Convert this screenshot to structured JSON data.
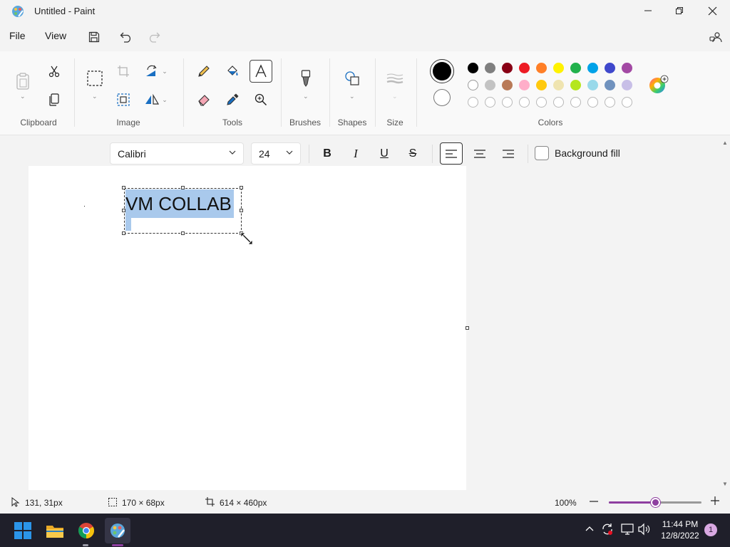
{
  "window": {
    "title": "Untitled - Paint"
  },
  "menu": {
    "file": "File",
    "view": "View"
  },
  "ribbon": {
    "groups": {
      "clipboard": "Clipboard",
      "image": "Image",
      "tools": "Tools",
      "brushes": "Brushes",
      "shapes": "Shapes",
      "size": "Size",
      "colors": "Colors"
    },
    "colors": {
      "primary": "#000000",
      "secondary": "#ffffff",
      "palette_row1": [
        "#000000",
        "#7f7f7f",
        "#880015",
        "#ed1c24",
        "#ff7f27",
        "#fff200",
        "#22b14c",
        "#00a2e8",
        "#3f48cc",
        "#a349a4"
      ],
      "palette_row2": [
        "#ffffff",
        "#c3c3c3",
        "#b97a57",
        "#ffaec9",
        "#ffc90e",
        "#efe4b0",
        "#b5e61d",
        "#99d9ea",
        "#7092be",
        "#c8bfe7"
      ]
    }
  },
  "textbar": {
    "font": "Calibri",
    "size": "24",
    "background_fill": "Background fill",
    "bold": "B",
    "italic": "I",
    "underline": "U",
    "strike": "S"
  },
  "canvas": {
    "text": "VM COLLAB"
  },
  "status": {
    "cursor": "131, 31px",
    "selection": "170 × 68px",
    "canvas_size": "614 × 460px",
    "zoom": "100%",
    "zoom_level": 0.5
  },
  "taskbar": {
    "time": "11:44 PM",
    "date": "12/8/2022",
    "notification_count": "1"
  },
  "accent": "#8e3fa0"
}
